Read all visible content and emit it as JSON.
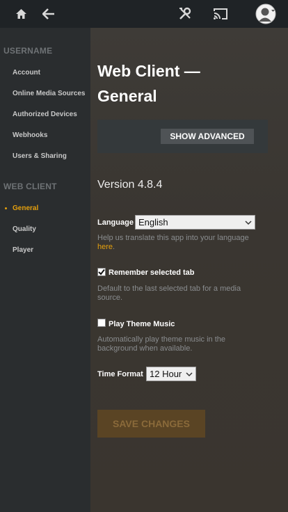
{
  "topbar": {
    "home_icon": "home-icon",
    "back_icon": "back-arrow-icon",
    "settings_icon": "wrench-screwdriver-icon",
    "cast_icon": "cast-icon",
    "avatar_icon": "user-avatar-icon"
  },
  "sidebar": {
    "section1_heading": "USERNAME",
    "section1_items": [
      "Account",
      "Online Media Sources",
      "Authorized Devices",
      "Webhooks",
      "Users & Sharing"
    ],
    "section2_heading": "WEB CLIENT",
    "section2_items": [
      "General",
      "Quality",
      "Player"
    ],
    "active_item": "General"
  },
  "main": {
    "title_line1": "Web Client —",
    "title_line2": "General",
    "show_advanced_label": "SHOW ADVANCED",
    "version": "Version 4.8.4",
    "language": {
      "label": "Language",
      "value": "English",
      "help_text": "Help us translate this app into your language",
      "help_link": "here",
      "help_suffix": "."
    },
    "remember_tab": {
      "label": "Remember selected tab",
      "checked": true,
      "help_text": "Default to the last selected tab for a media source."
    },
    "theme_music": {
      "label": "Play Theme Music",
      "checked": false,
      "help_text": "Automatically play theme music in the background when available."
    },
    "time_format": {
      "label": "Time Format",
      "value": "12 Hour"
    },
    "save_label": "SAVE CHANGES"
  },
  "colors": {
    "accent": "#e5a00d",
    "topbar": "#1f2326",
    "sidebar": "#2a2d2f"
  }
}
